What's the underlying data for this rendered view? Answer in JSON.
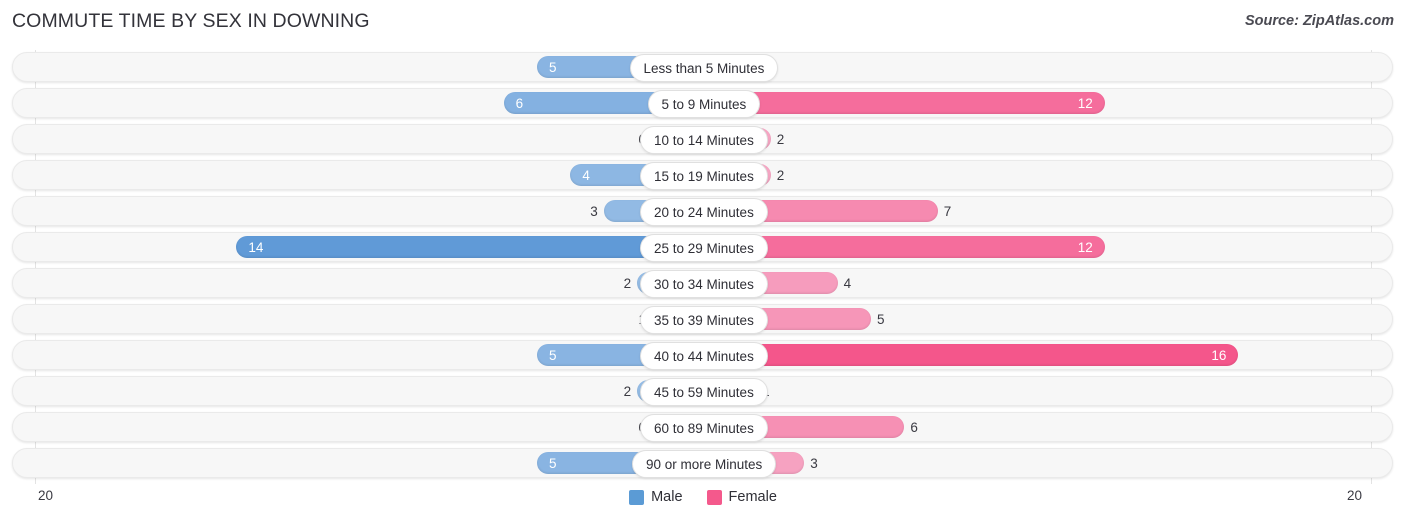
{
  "header": {
    "title": "COMMUTE TIME BY SEX IN DOWNING",
    "source": "Source: ZipAtlas.com"
  },
  "axis": {
    "left_tick": "20",
    "right_tick": "20"
  },
  "legend": {
    "items": [
      {
        "label": "Male",
        "color": "#5b9bd5"
      },
      {
        "label": "Female",
        "color": "#f4598c"
      }
    ]
  },
  "colors": {
    "male_min": "#9fc3e8",
    "male_max": "#5794d4",
    "female_min": "#f7b3cd",
    "female_max": "#f4568b",
    "track_bg": "#f7f7f7",
    "pill_bg": "#ffffff",
    "title": "#33333a"
  },
  "chart_data": {
    "type": "bar",
    "orientation": "horizontal",
    "layout": "diverging-bidirectional",
    "title": "COMMUTE TIME BY SEX IN DOWNING",
    "subtitle": "",
    "xlabel": "",
    "ylabel": "",
    "source": "Source: ZipAtlas.com",
    "xlim": [
      20,
      20
    ],
    "axis_max": 20,
    "grid": false,
    "legend_position": "bottom-center",
    "categories": [
      "Less than 5 Minutes",
      "5 to 9 Minutes",
      "10 to 14 Minutes",
      "15 to 19 Minutes",
      "20 to 24 Minutes",
      "25 to 29 Minutes",
      "30 to 34 Minutes",
      "35 to 39 Minutes",
      "40 to 44 Minutes",
      "45 to 59 Minutes",
      "60 to 89 Minutes",
      "90 or more Minutes"
    ],
    "series": [
      {
        "name": "Male",
        "side": "left",
        "values": [
          5,
          6,
          0,
          4,
          3,
          14,
          2,
          1,
          5,
          2,
          0,
          5
        ]
      },
      {
        "name": "Female",
        "side": "right",
        "values": [
          0,
          12,
          2,
          2,
          7,
          12,
          4,
          5,
          16,
          1,
          6,
          3
        ]
      }
    ],
    "value_labels": {
      "Male": [
        "5",
        "6",
        "0",
        "4",
        "3",
        "14",
        "2",
        "1",
        "5",
        "2",
        "0",
        "5"
      ],
      "Female": [
        "0",
        "12",
        "2",
        "2",
        "7",
        "12",
        "4",
        "5",
        "16",
        "1",
        "6",
        "3"
      ]
    }
  }
}
